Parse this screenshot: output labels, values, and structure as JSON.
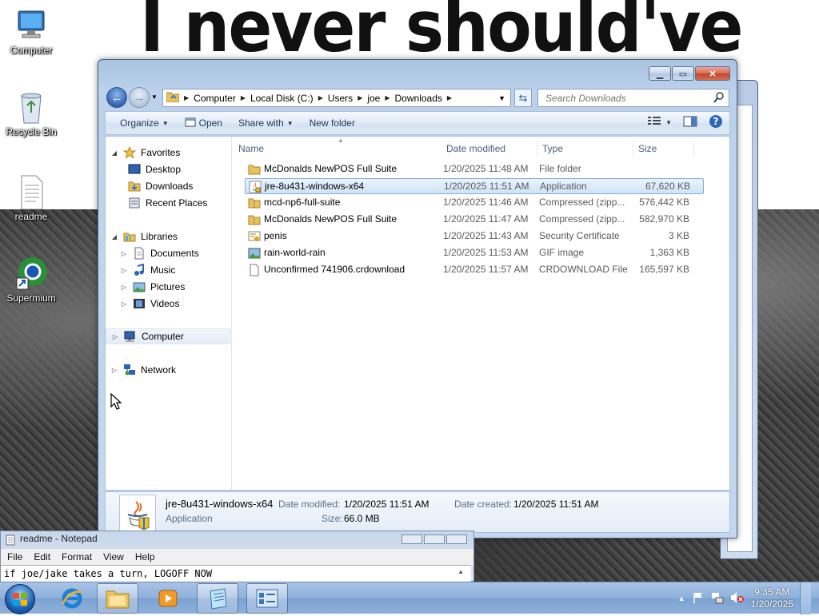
{
  "desktop": {
    "wallpaper_text": "I never should've",
    "icons": [
      {
        "label": "Computer",
        "icon": "computer-icon"
      },
      {
        "label": "Recycle Bin",
        "icon": "recycle-bin-icon"
      },
      {
        "label": "readme",
        "icon": "text-document-icon"
      },
      {
        "label": "Supermium",
        "icon": "browser-shortcut-icon"
      }
    ]
  },
  "explorer": {
    "breadcrumb": [
      "Computer",
      "Local Disk (C:)",
      "Users",
      "joe",
      "Downloads"
    ],
    "search_placeholder": "Search Downloads",
    "toolbar": {
      "organize": "Organize",
      "open": "Open",
      "share_with": "Share with",
      "new_folder": "New folder"
    },
    "nav": {
      "favorites": "Favorites",
      "favorites_items": [
        "Desktop",
        "Downloads",
        "Recent Places"
      ],
      "libraries": "Libraries",
      "libraries_items": [
        "Documents",
        "Music",
        "Pictures",
        "Videos"
      ],
      "computer": "Computer",
      "network": "Network"
    },
    "columns": {
      "name": "Name",
      "date": "Date modified",
      "type": "Type",
      "size": "Size"
    },
    "files": [
      {
        "name": "McDonalds NewPOS Full Suite",
        "date": "1/20/2025 11:48 AM",
        "type": "File folder",
        "size": "",
        "icon": "folder-icon"
      },
      {
        "name": "jre-8u431-windows-x64",
        "date": "1/20/2025 11:51 AM",
        "type": "Application",
        "size": "67,620 KB",
        "icon": "java-installer-icon",
        "selected": true
      },
      {
        "name": "mcd-np6-full-suite",
        "date": "1/20/2025 11:46 AM",
        "type": "Compressed (zipp...",
        "size": "576,442 KB",
        "icon": "zip-folder-icon"
      },
      {
        "name": "McDonalds NewPOS Full Suite",
        "date": "1/20/2025 11:47 AM",
        "type": "Compressed (zipp...",
        "size": "582,970 KB",
        "icon": "zip-folder-icon"
      },
      {
        "name": "penis",
        "date": "1/20/2025 11:43 AM",
        "type": "Security Certificate",
        "size": "3 KB",
        "icon": "certificate-icon"
      },
      {
        "name": "rain-world-rain",
        "date": "1/20/2025 11:53 AM",
        "type": "GIF image",
        "size": "1,363 KB",
        "icon": "image-file-icon"
      },
      {
        "name": "Unconfirmed 741906.crdownload",
        "date": "1/20/2025 11:57 AM",
        "type": "CRDOWNLOAD File",
        "size": "165,597 KB",
        "icon": "blank-file-icon"
      }
    ],
    "details": {
      "name": "jre-8u431-windows-x64",
      "type": "Application",
      "date_modified_label": "Date modified:",
      "date_modified": "1/20/2025 11:51 AM",
      "date_created_label": "Date created:",
      "date_created": "1/20/2025 11:51 AM",
      "size_label": "Size:",
      "size": "66.0 MB"
    }
  },
  "notepad": {
    "title": "readme - Notepad",
    "menu": [
      "File",
      "Edit",
      "Format",
      "View",
      "Help"
    ],
    "content": "if joe/jake takes a turn, LOGOFF NOW"
  },
  "taskbar": {
    "clock_time": "9:35 AM",
    "clock_date": "1/20/2025",
    "accent": "#8db0db"
  }
}
